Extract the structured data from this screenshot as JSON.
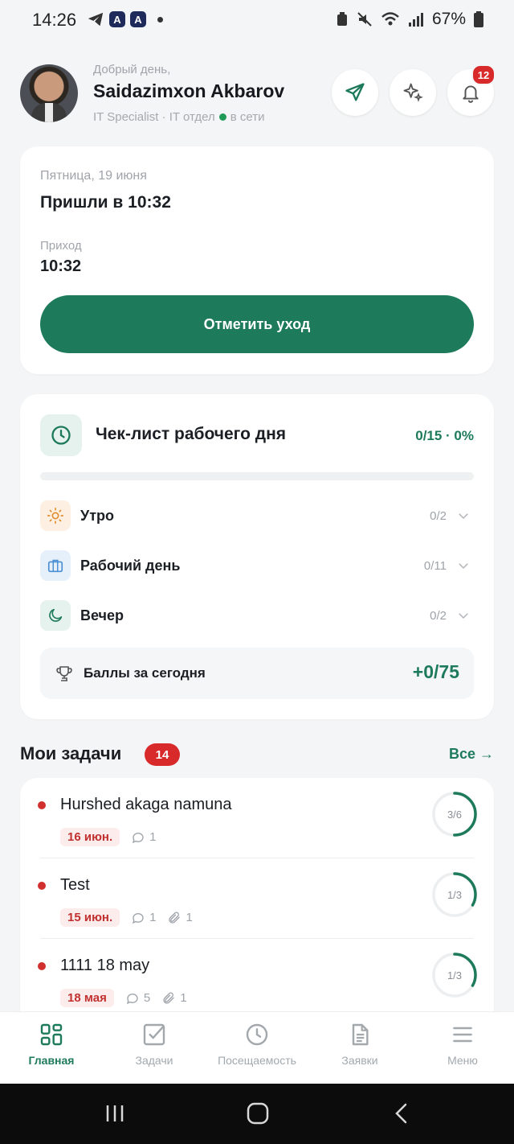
{
  "status_bar": {
    "time": "14:26",
    "battery": "67%"
  },
  "header": {
    "greeting": "Добрый день,",
    "user_name": "Saidazimxon Akbarov",
    "role": "IT Specialist · IT отдел",
    "status": "в сети",
    "notifications_count": "12"
  },
  "attendance": {
    "date": "Пятница, 19 июня",
    "arrived_text": "Пришли в 10:32",
    "arrival_label": "Приход",
    "arrival_time": "10:32",
    "checkout_button": "Отметить уход"
  },
  "checklist": {
    "title": "Чек-лист рабочего дня",
    "progress": "0/15 · 0%",
    "progress_fraction": 0,
    "sections": [
      {
        "label": "Утро",
        "count": "0/2",
        "icon": "sun-icon"
      },
      {
        "label": "Рабочий день",
        "count": "0/11",
        "icon": "briefcase-icon"
      },
      {
        "label": "Вечер",
        "count": "0/2",
        "icon": "moon-icon"
      }
    ],
    "points_label": "Баллы за сегодня",
    "points_value": "+0/75"
  },
  "tasks": {
    "title": "Мои задачи",
    "count": "14",
    "all_link": "Все →",
    "items": [
      {
        "title": "Hurshed akaga namuna",
        "date": "16 июн.",
        "comments": "1",
        "attachments": "",
        "progress": "3/6",
        "fraction": 0.5
      },
      {
        "title": "Test",
        "date": "15 июн.",
        "comments": "1",
        "attachments": "1",
        "progress": "1/3",
        "fraction": 0.3333
      },
      {
        "title": "1111 18 may",
        "date": "18 мая",
        "comments": "5",
        "attachments": "1",
        "progress": "1/3",
        "fraction": 0.3333
      }
    ]
  },
  "tabbar": {
    "items": [
      {
        "label": "Главная",
        "icon": "grid-icon",
        "active": true
      },
      {
        "label": "Задачи",
        "icon": "checkbox-icon",
        "active": false
      },
      {
        "label": "Посещаемость",
        "icon": "clock-icon",
        "active": false
      },
      {
        "label": "Заявки",
        "icon": "document-icon",
        "active": false
      },
      {
        "label": "Меню",
        "icon": "menu-icon",
        "active": false
      }
    ]
  },
  "colors": {
    "accent": "#1d7a5b",
    "danger": "#d82a2a",
    "background": "#f4f5f6"
  }
}
